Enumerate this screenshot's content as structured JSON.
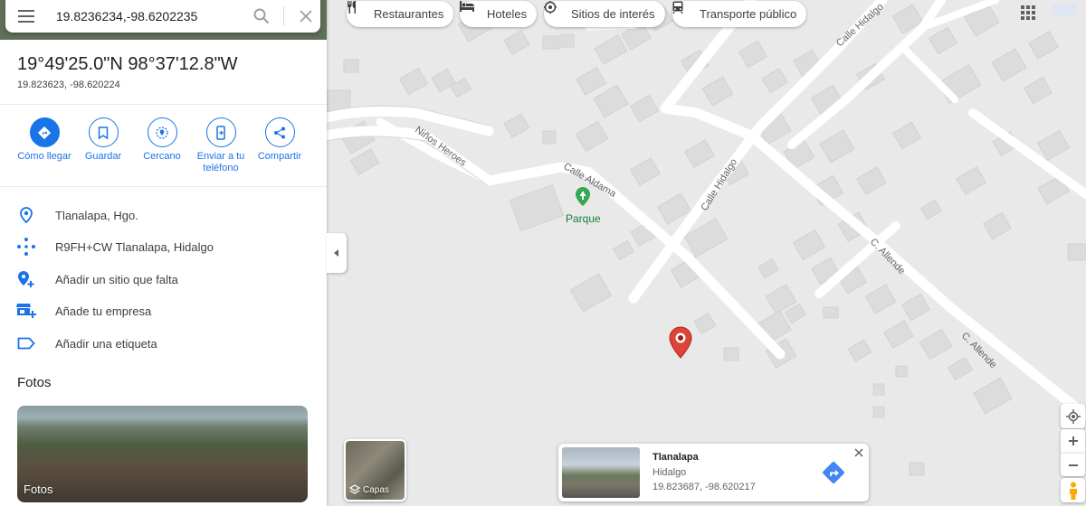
{
  "search": {
    "value": "19.8236234,-98.6202235"
  },
  "place": {
    "title": "19°49'25.0\"N 98°37'12.8\"W",
    "subtitle": "19.823623, -98.620224"
  },
  "actions": [
    {
      "label": "Cómo llegar"
    },
    {
      "label": "Guardar"
    },
    {
      "label": "Cercano"
    },
    {
      "label": "Enviar a tu teléfono"
    },
    {
      "label": "Compartir"
    }
  ],
  "info": [
    {
      "icon": "location-pin-icon",
      "text": "Tlanalapa, Hgo."
    },
    {
      "icon": "plus-code-icon",
      "text": "R9FH+CW Tlanalapa, Hidalgo"
    },
    {
      "icon": "add-place-icon",
      "text": "Añadir un sitio que falta"
    },
    {
      "icon": "add-business-icon",
      "text": "Añade tu empresa"
    },
    {
      "icon": "label-icon",
      "text": "Añadir una etiqueta"
    }
  ],
  "photos": {
    "heading": "Fotos",
    "label": "Fotos"
  },
  "chips": [
    {
      "icon": "restaurant-icon",
      "label": "Restaurantes"
    },
    {
      "icon": "hotel-icon",
      "label": "Hoteles"
    },
    {
      "icon": "attraction-icon",
      "label": "Sitios de interés"
    },
    {
      "icon": "transit-icon",
      "label": "Transporte público"
    }
  ],
  "map_labels": {
    "calle_hidalgo_top": "Calle Hidalgo",
    "ninos_heroes": "Niños Heroes",
    "calle_aldama": "Calle Aldama",
    "calle_hidalgo_mid": "Calle Hidalgo",
    "parque": "Parque",
    "c_allende_1": "C. Allende",
    "c_allende_2": "C. Allende"
  },
  "layers": {
    "label": "Capas"
  },
  "street_view": {
    "name": "Tlanalapa",
    "region": "Hidalgo",
    "coords": "19.823687, -98.620217"
  },
  "colors": {
    "accent": "#1a73e8",
    "pin": "#db4437",
    "park": "#34a853"
  }
}
